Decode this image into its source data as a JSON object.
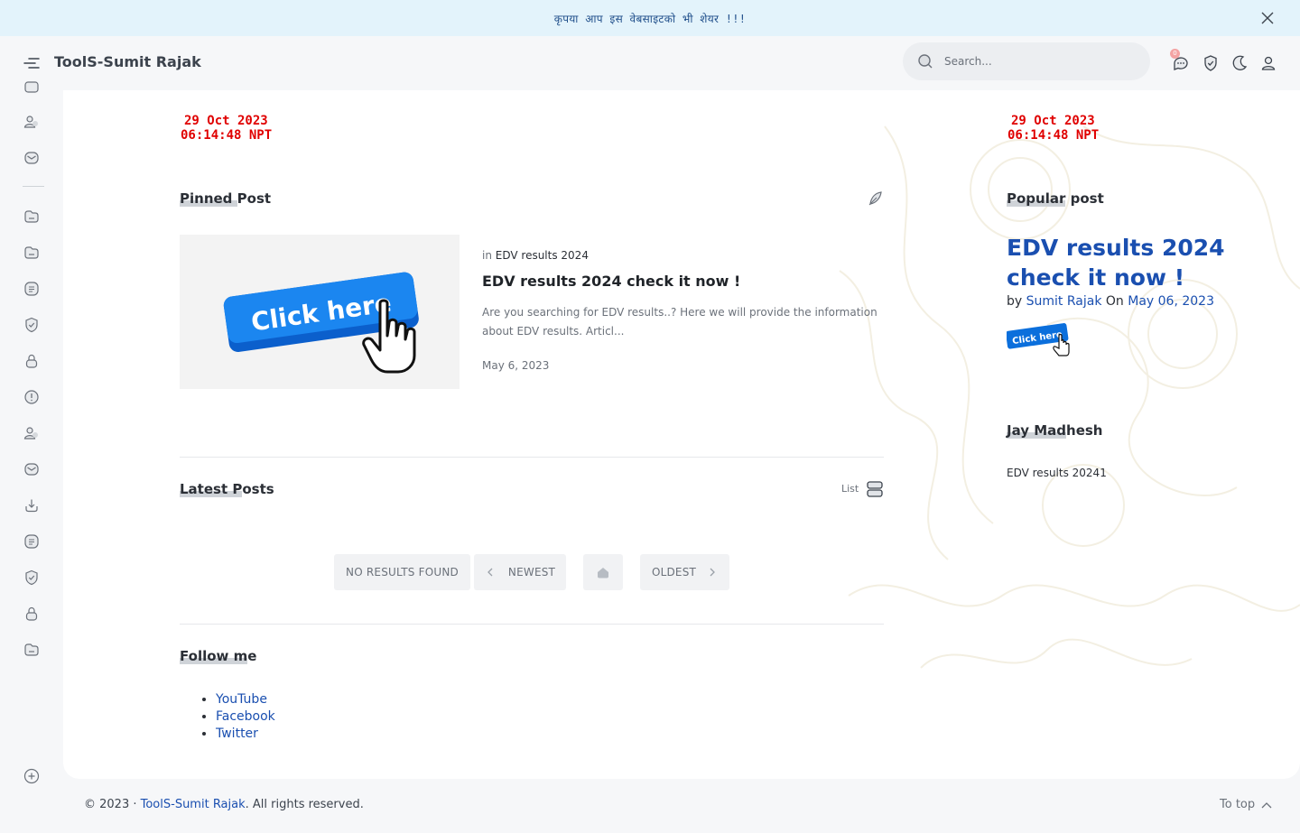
{
  "notice": {
    "text": "कृपया आप इस वेबसाइटको भी शेयर !!!"
  },
  "header": {
    "site_title": "ToolS-Sumit Rajak",
    "search_placeholder": "Search...",
    "notification_count": "0"
  },
  "clock": {
    "date": "29 Oct 2023",
    "time": "06:14:48 NPT"
  },
  "pinned": {
    "title_hl": "Pinned ",
    "title_rest": "Post",
    "in_label": "in ",
    "category": "EDV results 2024",
    "post_title": "EDV results 2024 check it now !",
    "snippet": "Are you searching for EDV results..? Here we will provide the information about EDV results. Articl...",
    "date": "May 6, 2023",
    "thumb_text": "Click here"
  },
  "latest": {
    "title_hl": "Latest P",
    "title_rest": "osts",
    "list_label": "List",
    "pager": {
      "no_results": "NO RESULTS FOUND",
      "newest": "NEWEST",
      "oldest": "OLDEST"
    }
  },
  "follow": {
    "title_hl": "Follow m",
    "title_rest": "e",
    "links": [
      "YouTube",
      "Facebook",
      "Twitter"
    ]
  },
  "popular": {
    "title_hl": "Popular",
    "title_rest": " post",
    "post_title": "EDV results 2024 check it now !",
    "by": "by ",
    "author": "Sumit Rajak",
    "on": " On ",
    "date": "May 06, 2023",
    "thumb_text": "Click here"
  },
  "jay": {
    "title_hl": "Jay Mad",
    "title_rest": "hesh",
    "text": "EDV results 20241"
  },
  "footer": {
    "copyright": "© 2023 · ",
    "site_link": "ToolS-Sumit Rajak",
    "rights": ". All rights reserved.",
    "to_top": "To top"
  }
}
